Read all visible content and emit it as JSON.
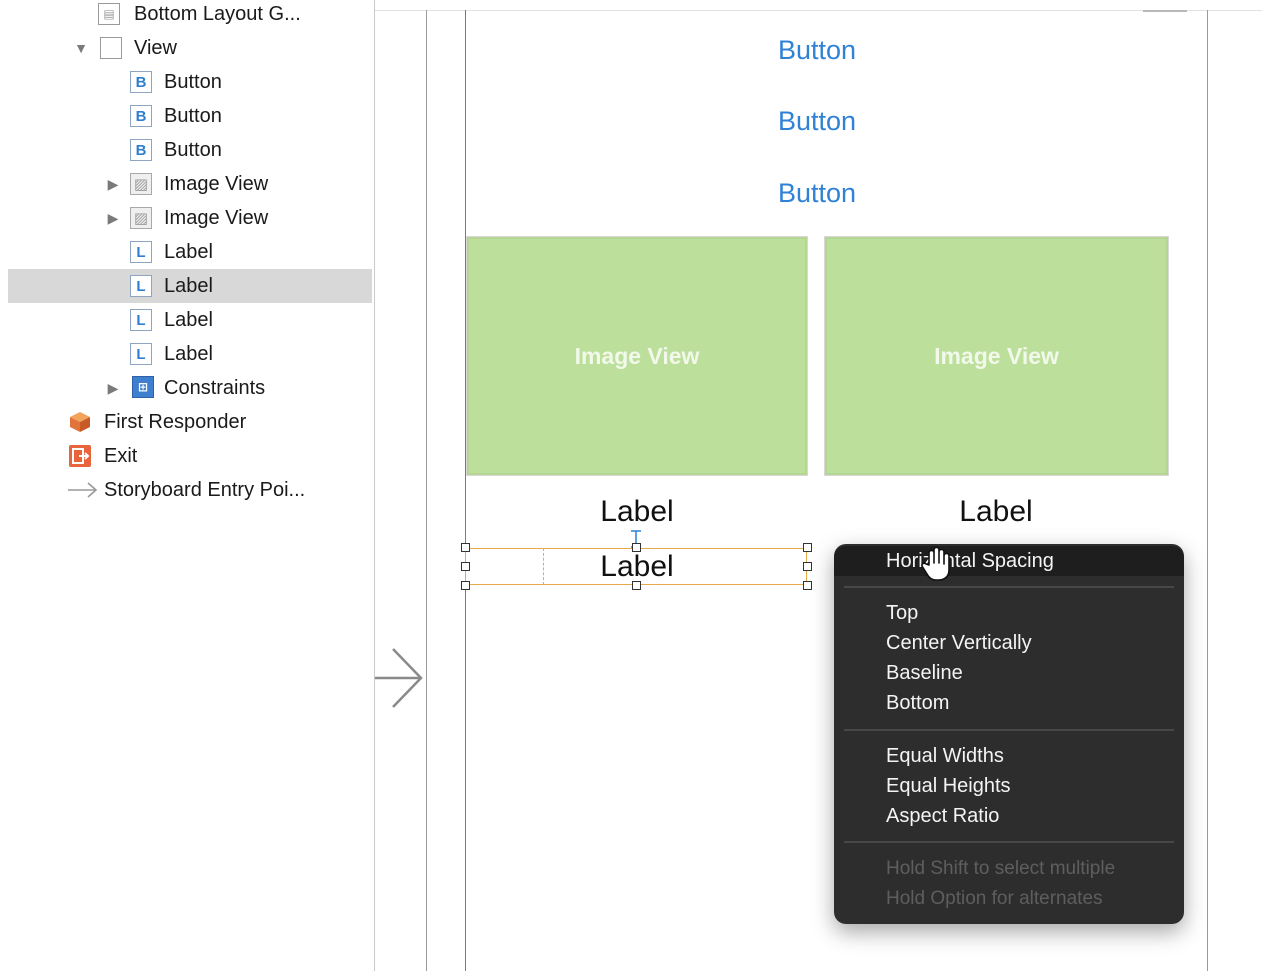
{
  "outline": {
    "items": [
      {
        "label": "Bottom Layout G...",
        "icon": "layout-guide-icon"
      },
      {
        "label": "View",
        "icon": "view-icon"
      },
      {
        "label": "Button",
        "icon": "button-icon",
        "badge": "B"
      },
      {
        "label": "Button",
        "icon": "button-icon",
        "badge": "B"
      },
      {
        "label": "Button",
        "icon": "button-icon",
        "badge": "B"
      },
      {
        "label": "Image View",
        "icon": "image-view-icon"
      },
      {
        "label": "Image View",
        "icon": "image-view-icon"
      },
      {
        "label": "Label",
        "icon": "label-icon",
        "badge": "L"
      },
      {
        "label": "Label",
        "icon": "label-icon",
        "badge": "L"
      },
      {
        "label": "Label",
        "icon": "label-icon",
        "badge": "L"
      },
      {
        "label": "Label",
        "icon": "label-icon",
        "badge": "L"
      },
      {
        "label": "Constraints",
        "icon": "constraints-icon"
      },
      {
        "label": "First Responder",
        "icon": "first-responder-icon"
      },
      {
        "label": "Exit",
        "icon": "exit-icon"
      },
      {
        "label": "Storyboard Entry Poi...",
        "icon": "entry-point-icon"
      }
    ],
    "selected_index": 8
  },
  "canvas": {
    "buttons": [
      "Button",
      "Button",
      "Button"
    ],
    "image_views": [
      "Image View",
      "Image View"
    ],
    "labels": [
      "Label",
      "Label",
      "Label"
    ]
  },
  "context_menu": {
    "highlighted": "Horizontal Spacing",
    "group_vertical": [
      "Top",
      "Center Vertically",
      "Baseline",
      "Bottom"
    ],
    "group_size": [
      "Equal Widths",
      "Equal Heights",
      "Aspect Ratio"
    ],
    "hints": [
      "Hold Shift to select multiple",
      "Hold Option for alternates"
    ]
  },
  "colors": {
    "button_text": "#2f82d6",
    "image_view_fill": "#bcdf9b",
    "selection_frame": "#e7a94a",
    "menu_bg": "#2d2d2d",
    "outline_selected": "#d8d8d8"
  }
}
